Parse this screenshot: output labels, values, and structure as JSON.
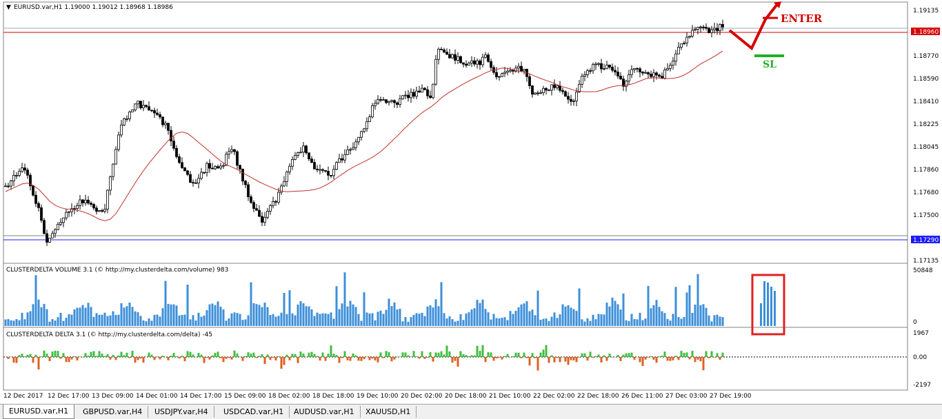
{
  "main_chart": {
    "title": "EURUSD.var,H1  1.19000 1.19012 1.18968 1.18986",
    "price_axis": [
      "1.19135",
      "1.18955",
      "1.18770",
      "1.18590",
      "1.18410",
      "1.18225",
      "1.18045",
      "1.17860",
      "1.17680",
      "1.17500",
      "1.17315",
      "1.17135"
    ],
    "level_high": "1.18960",
    "level_low": "1.17290",
    "annotation_enter": "ENTER",
    "annotation_sl": "SL",
    "colors": {
      "bull": "#000000",
      "bear": "#000000",
      "ma": "#c0302a",
      "level_high": "#d60000",
      "level_low": "#1a1aff",
      "enter": "#d40000",
      "sl": "#22b022"
    }
  },
  "volume_panel": {
    "title": "CLUSTERDELTA VOLUME 3.1 (© http://my.clusterdelta.com/volume) 983",
    "axis_max": "50848",
    "axis_min": "0",
    "color": "#3d8fd9",
    "highlight_color": "#e02020"
  },
  "delta_panel": {
    "title": "CLUSTERDELTA DELTA 3.1 (© http://my.clusterdelta.com/delta) -45",
    "axis_max": "1967",
    "axis_zero": "0.00",
    "axis_min": "-2197",
    "pos_color": "#3fbf3f",
    "neg_color": "#e06020"
  },
  "time_axis": [
    "12 Dec 2017",
    "12 Dec 17:00",
    "13 Dec 09:00",
    "14 Dec 01:00",
    "14 Dec 17:00",
    "15 Dec 09:00",
    "18 Dec 02:00",
    "18 Dec 18:00",
    "19 Dec 10:00",
    "20 Dec 02:00",
    "20 Dec 18:00",
    "21 Dec 10:00",
    "22 Dec 02:00",
    "22 Dec 18:00",
    "26 Dec 11:00",
    "27 Dec 03:00",
    "27 Dec 19:00"
  ],
  "tabs": [
    {
      "label": "EURUSD.var,H1",
      "active": true
    },
    {
      "label": "GBPUSD.var,H4",
      "active": false
    },
    {
      "label": "USDJPY.var,H4",
      "active": false
    },
    {
      "label": "USDCAD.var,H1",
      "active": false
    },
    {
      "label": "AUDUSD.var,H1",
      "active": false
    },
    {
      "label": "XAUUSD,H1",
      "active": false
    }
  ]
}
